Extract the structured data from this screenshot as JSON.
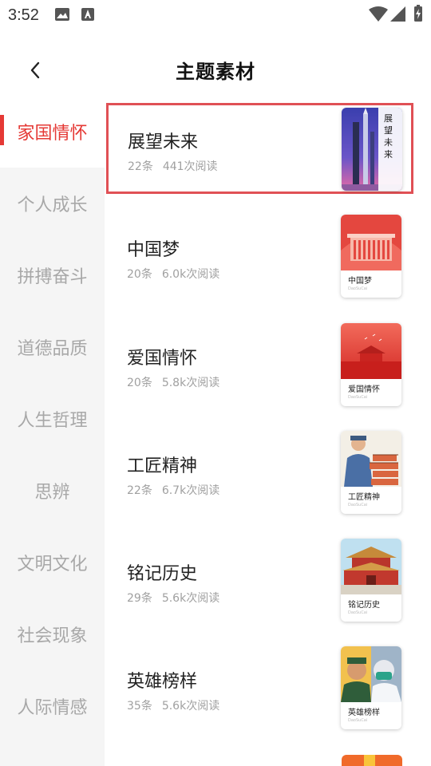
{
  "status_bar": {
    "time": "3:52"
  },
  "header": {
    "title": "主题素材"
  },
  "sidebar": {
    "items": [
      {
        "label": "家国情怀",
        "active": true
      },
      {
        "label": "个人成长"
      },
      {
        "label": "拼搏奋斗"
      },
      {
        "label": "道德品质"
      },
      {
        "label": "人生哲理"
      },
      {
        "label": "思辨"
      },
      {
        "label": "文明文化"
      },
      {
        "label": "社会现象"
      },
      {
        "label": "人际情感"
      }
    ]
  },
  "topics": [
    {
      "title": "展望未来",
      "count": "22条",
      "reads": "441次阅读",
      "thumb_text": "展望未来",
      "selected": true
    },
    {
      "title": "中国梦",
      "count": "20条",
      "reads": "6.0k次阅读",
      "thumb_label": "中国梦"
    },
    {
      "title": "爱国情怀",
      "count": "20条",
      "reads": "5.8k次阅读",
      "thumb_label": "爱国情怀"
    },
    {
      "title": "工匠精神",
      "count": "22条",
      "reads": "6.7k次阅读",
      "thumb_label": "工匠精神"
    },
    {
      "title": "铭记历史",
      "count": "29条",
      "reads": "5.6k次阅读",
      "thumb_label": "铭记历史"
    },
    {
      "title": "英雄榜样",
      "count": "35条",
      "reads": "5.6k次阅读",
      "thumb_label": "英雄榜样"
    }
  ],
  "thumb_watermark": "DaoSuCai",
  "colors": {
    "accent": "#e53935",
    "sidebar_bg": "#f5f5f5",
    "muted_text": "#a0a0a0",
    "selected_outline": "#e05055"
  }
}
